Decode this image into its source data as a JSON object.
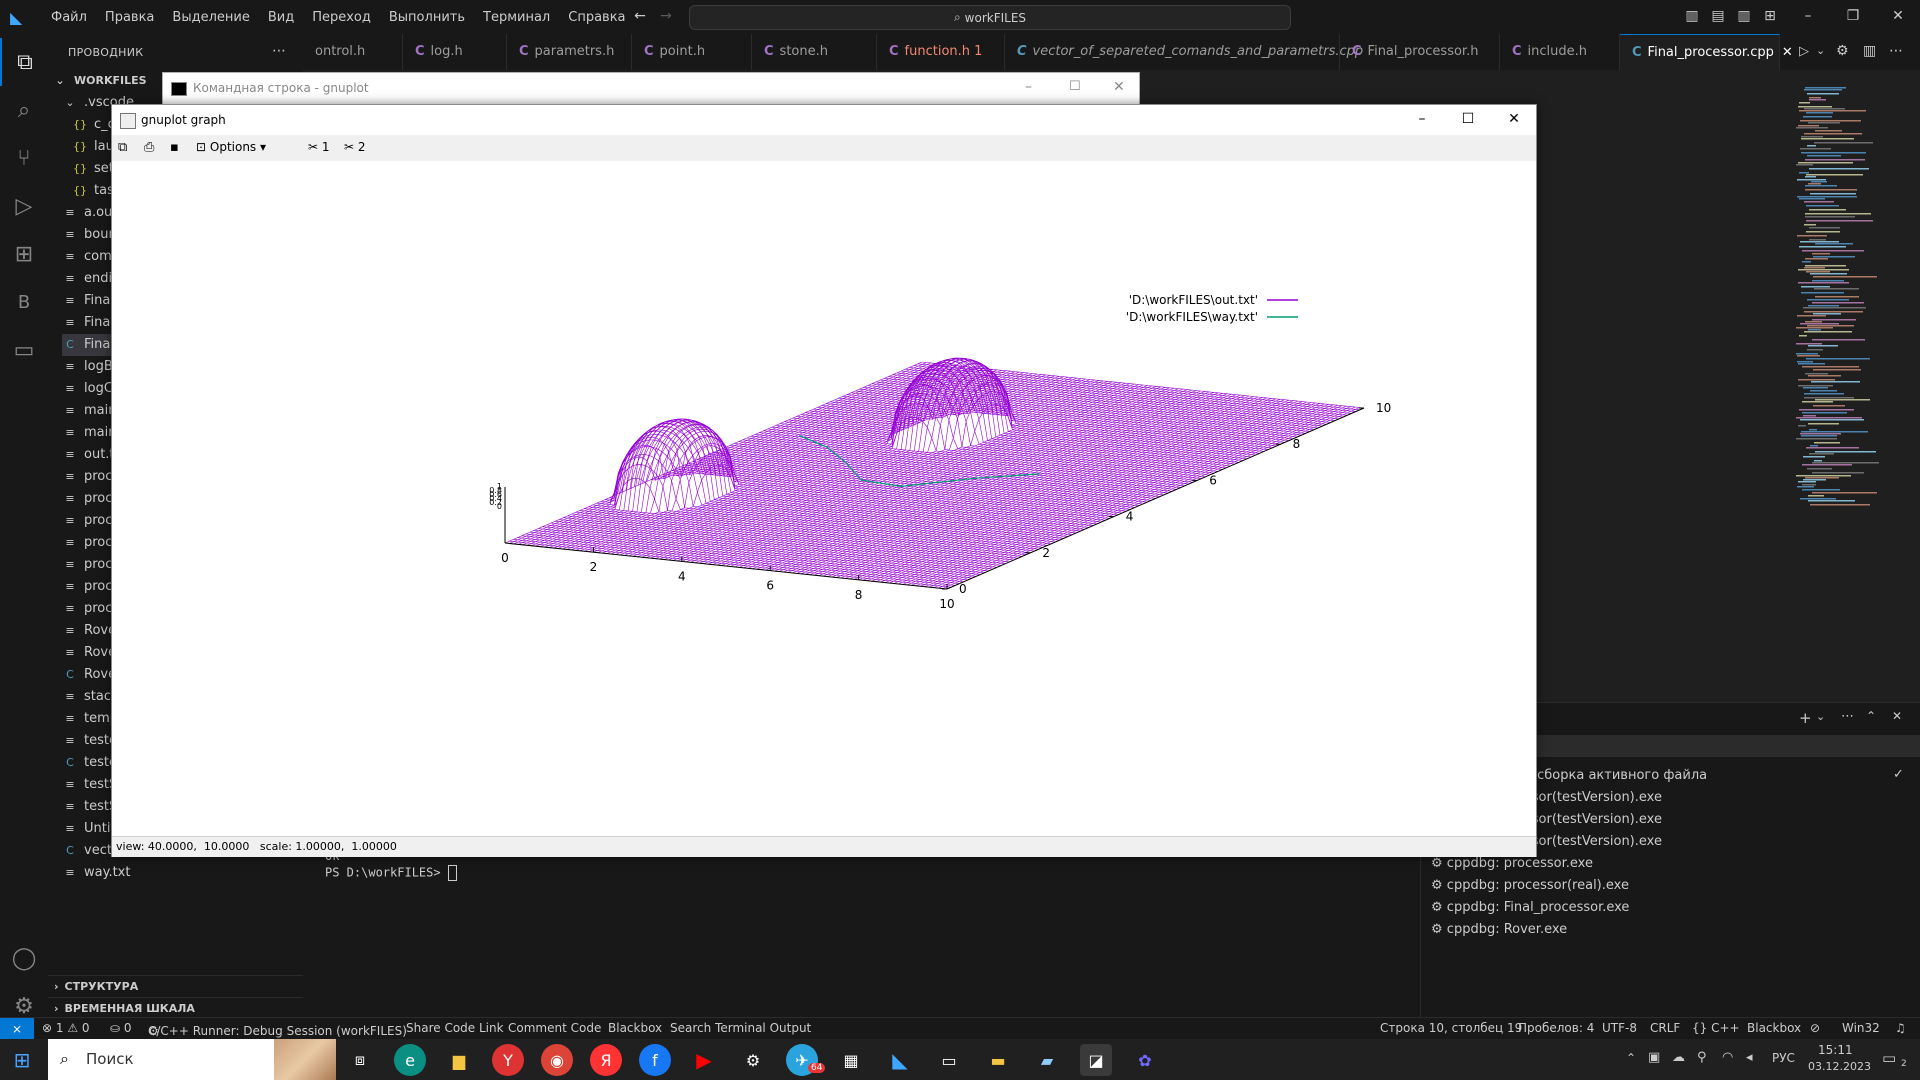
{
  "titlebar": {
    "menu": [
      "Файл",
      "Правка",
      "Выделение",
      "Вид",
      "Переход",
      "Выполнить",
      "Терминал",
      "Справка"
    ],
    "search": "workFILES"
  },
  "sidebar": {
    "header": "ПРОВОДНИК",
    "root": "WORKFILES",
    "folder": ".vscode",
    "items": [
      "c_cp",
      "laun",
      "sett",
      "task",
      "a.out",
      "boun",
      "coma",
      "endir",
      "Final_",
      "Final_",
      "Final_",
      "logB.",
      "logC.",
      "main.",
      "main.",
      "out.t",
      "proce",
      "proce",
      "proce",
      "proce",
      "proce",
      "proce",
      "proce",
      "Rove",
      "Rove",
      "Rove",
      "stack",
      "temp",
      "teste",
      "teste",
      "testS",
      "testS",
      "Untit",
      "vecto",
      "way.txt"
    ],
    "outline": "СТРУКТУРА",
    "timeline": "ВРЕМЕННАЯ ШКАЛА"
  },
  "tabs": [
    {
      "label": "ontrol.h",
      "color": "#9d9d9d"
    },
    {
      "label": "log.h",
      "color": "#9d9d9d"
    },
    {
      "label": "parametrs.h",
      "color": "#9d9d9d"
    },
    {
      "label": "point.h",
      "color": "#9d9d9d"
    },
    {
      "label": "stone.h",
      "color": "#9d9d9d"
    },
    {
      "label": "function.h 1",
      "color": "#f48771"
    },
    {
      "label": "vector_of_separeted_comands_and_parametrs.cpp",
      "color": "#9d9d9d"
    },
    {
      "label": "Final_processor.h",
      "color": "#9d9d9d"
    },
    {
      "label": "include.h",
      "color": "#9d9d9d"
    },
    {
      "label": "Final_processor.cpp",
      "color": "#ffffff"
    }
  ],
  "terminal": {
    "line1": "ok",
    "prompt": "PS D:\\workFILES> "
  },
  "panel_list": [
    "е сборка активного файла",
    "ssor(testVersion).exe",
    "ssor(testVersion).exe",
    "ssor(testVersion).exe",
    "cppdbg: processor.exe",
    "cppdbg: processor(real).exe",
    "cppdbg: Final_processor.exe",
    "cppdbg: Rover.exe"
  ],
  "cmd_window": {
    "title": "Командная строка - gnuplot"
  },
  "gnuplot": {
    "title": "gnuplot graph",
    "options_label": "Options",
    "tool1": "1",
    "tool2": "2",
    "status": "view: 40.0000,  10.0000   scale: 1.00000,  1.00000"
  },
  "chart_data": {
    "type": "surface3d",
    "series": [
      {
        "name": "'D:\\workFILES\\out.txt'",
        "color": "#9400d3"
      },
      {
        "name": "'D:\\workFILES\\way.txt'",
        "color": "#009e73"
      }
    ],
    "x_ticks": [
      "0",
      "2",
      "4",
      "6",
      "8",
      "10"
    ],
    "y_ticks": [
      "0",
      "2",
      "4",
      "6",
      "8",
      "10"
    ],
    "z_ticks": [
      "1",
      "0.8",
      "0.6",
      "0.4",
      "0.2",
      "0"
    ],
    "xlim": [
      0,
      10
    ],
    "ylim": [
      0,
      10
    ],
    "zlim": [
      0,
      1
    ],
    "bumps": [
      {
        "x": 1.0,
        "y": 3.0,
        "z": 1.0
      },
      {
        "x": 3.5,
        "y": 7.0,
        "z": 1.0
      }
    ],
    "path": [
      [
        1.0,
        6.0
      ],
      [
        2.0,
        5.6
      ],
      [
        3.0,
        5.0
      ],
      [
        4.0,
        4.3
      ],
      [
        5.0,
        4.2
      ],
      [
        6.0,
        4.9
      ],
      [
        7.0,
        5.4
      ]
    ],
    "legend_position": "top-right"
  },
  "statusbar": {
    "errors": "⊗ 1 ⚠ 0",
    "ports": "⛀ 0",
    "runner": "C/C++ Runner: Debug Session (workFILES)",
    "share": "Share Code Link",
    "comment": "Comment Code",
    "blackbox": "Blackbox",
    "search_term": "Search Terminal Output",
    "position": "Строка 10, столбец 19",
    "spaces": "Пробелов: 4",
    "encoding": "UTF-8",
    "eol": "CRLF",
    "lang": "{} C++",
    "blackbox2": "Blackbox",
    "platform": "Win32"
  },
  "taskbar": {
    "search": "Поиск",
    "time": "15:11",
    "date": "03.12.2023",
    "lang": "РУС",
    "badge": "64",
    "notif": "2"
  }
}
